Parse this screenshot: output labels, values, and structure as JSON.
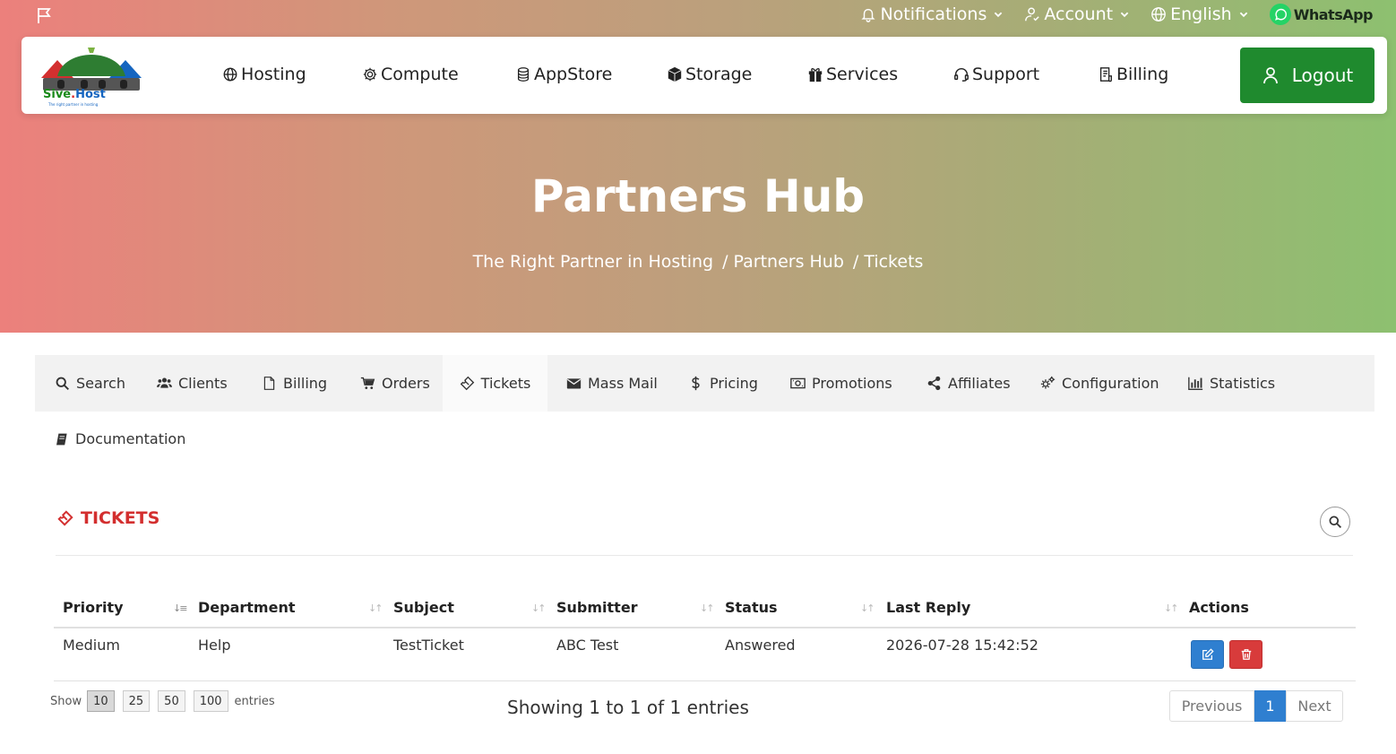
{
  "topbar": {
    "notifications": "Notifications",
    "account": "Account",
    "language": "English",
    "whatsapp": "WhatsApp"
  },
  "logo": {
    "name_part1": "Sive",
    "name_dot": ".",
    "name_part2": "Host",
    "tagline": "The right partner in hosting"
  },
  "mainnav": [
    {
      "label": "Hosting",
      "icon": "globe-icon"
    },
    {
      "label": "Compute",
      "icon": "gear-icon"
    },
    {
      "label": "AppStore",
      "icon": "database-icon"
    },
    {
      "label": "Storage",
      "icon": "cube-icon"
    },
    {
      "label": "Services",
      "icon": "gift-icon"
    },
    {
      "label": "Support",
      "icon": "headset-icon"
    },
    {
      "label": "Billing",
      "icon": "receipt-icon"
    }
  ],
  "logout_label": "Logout",
  "hero": {
    "title": "Partners Hub",
    "breadcrumb": [
      "The Right Partner in Hosting",
      "Partners Hub",
      "Tickets"
    ]
  },
  "tabs": [
    {
      "label": "Search",
      "icon": "search-icon"
    },
    {
      "label": "Clients",
      "icon": "users-icon"
    },
    {
      "label": "Billing",
      "icon": "file-icon"
    },
    {
      "label": "Orders",
      "icon": "cart-icon"
    },
    {
      "label": "Tickets",
      "icon": "ticket-icon",
      "active": true
    },
    {
      "label": "Mass Mail",
      "icon": "envelope-icon"
    },
    {
      "label": "Pricing",
      "icon": "dollar-icon"
    },
    {
      "label": "Promotions",
      "icon": "money-icon"
    },
    {
      "label": "Affiliates",
      "icon": "share-icon"
    },
    {
      "label": "Configuration",
      "icon": "cogs-icon"
    },
    {
      "label": "Statistics",
      "icon": "bar-chart-icon"
    },
    {
      "label": "Documentation",
      "icon": "book-icon"
    }
  ],
  "section_title": "TICKETS",
  "table": {
    "headers": [
      "Priority",
      "Department",
      "Subject",
      "Submitter",
      "Status",
      "Last Reply",
      "Actions"
    ],
    "rows": [
      [
        "Medium",
        "Help",
        "TestTicket",
        "ABC Test",
        "Answered",
        "2026-07-28 15:42:52"
      ]
    ]
  },
  "length_menu": {
    "show": "Show",
    "options": [
      "10",
      "25",
      "50",
      "100"
    ],
    "selected": "10",
    "entries": "entries"
  },
  "info": "Showing 1 to 1 of 1 entries",
  "pagination": {
    "previous": "Previous",
    "current": "1",
    "next": "Next"
  },
  "colors": {
    "accent_green": "#1f8a2e",
    "ticket_red": "#d32f2f",
    "primary_blue": "#2f7fd0",
    "danger_red": "#d83b3b"
  }
}
